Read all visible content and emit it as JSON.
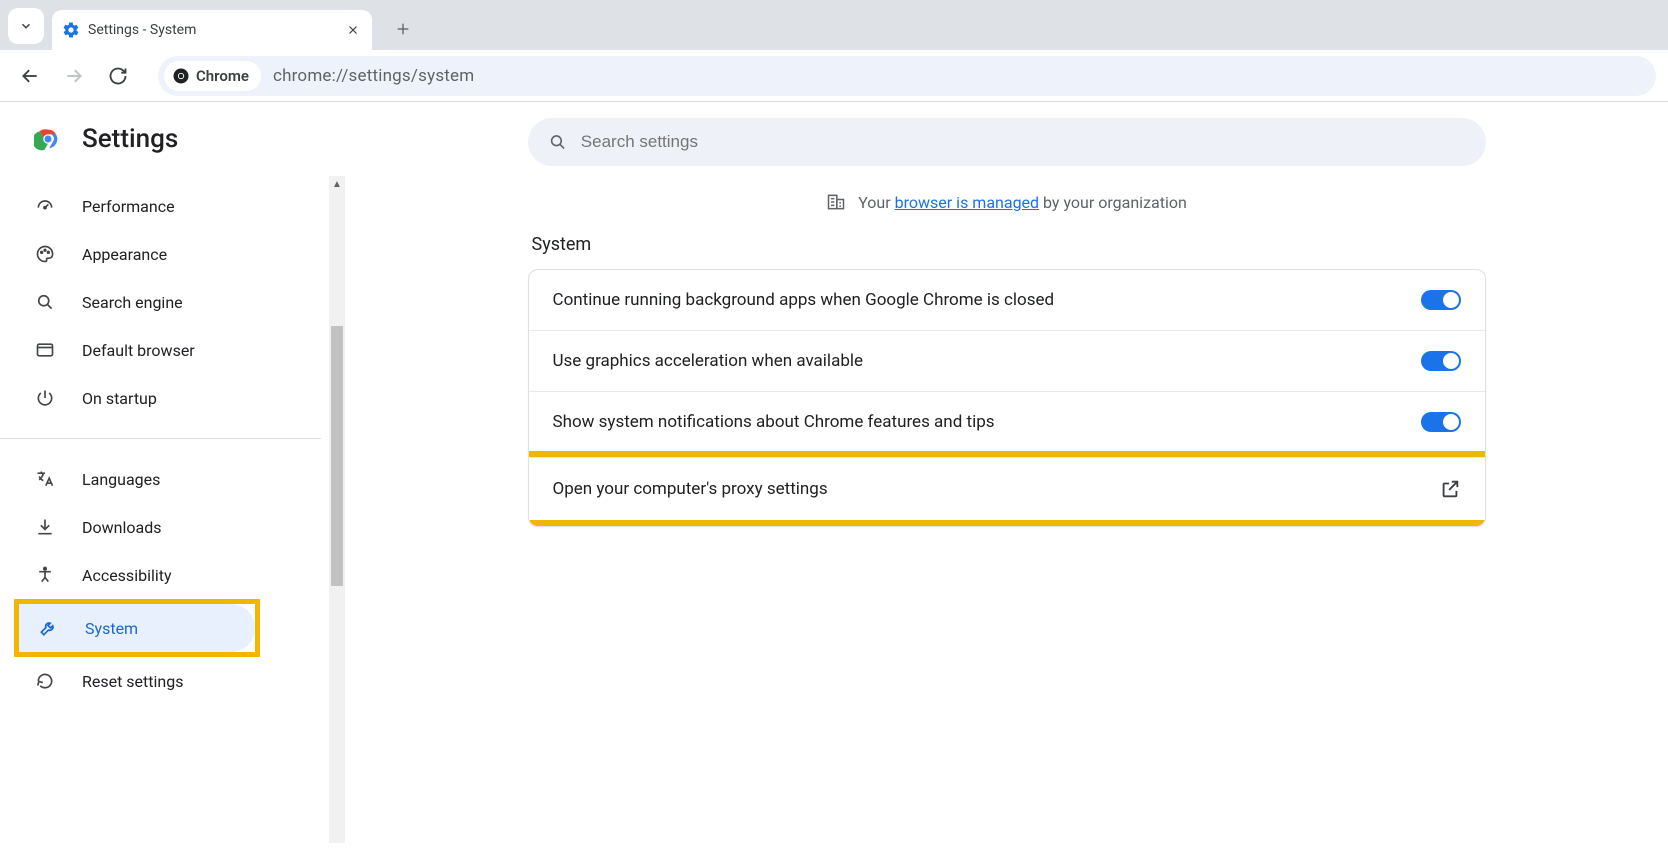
{
  "tab": {
    "title": "Settings - System"
  },
  "addressbar": {
    "chip_label": "Chrome",
    "url": "chrome://settings/system"
  },
  "settings_title": "Settings",
  "search": {
    "placeholder": "Search settings"
  },
  "managed": {
    "prefix": "Your ",
    "link": "browser is managed",
    "suffix": " by your organization"
  },
  "sidebar": {
    "items": [
      {
        "label": "Performance"
      },
      {
        "label": "Appearance"
      },
      {
        "label": "Search engine"
      },
      {
        "label": "Default browser"
      },
      {
        "label": "On startup"
      },
      {
        "label": "Languages"
      },
      {
        "label": "Downloads"
      },
      {
        "label": "Accessibility"
      },
      {
        "label": "System"
      },
      {
        "label": "Reset settings"
      }
    ]
  },
  "section": {
    "title": "System",
    "rows": [
      {
        "label": "Continue running background apps when Google Chrome is closed"
      },
      {
        "label": "Use graphics acceleration when available"
      },
      {
        "label": "Show system notifications about Chrome features and tips"
      },
      {
        "label": "Open your computer's proxy settings"
      }
    ]
  }
}
